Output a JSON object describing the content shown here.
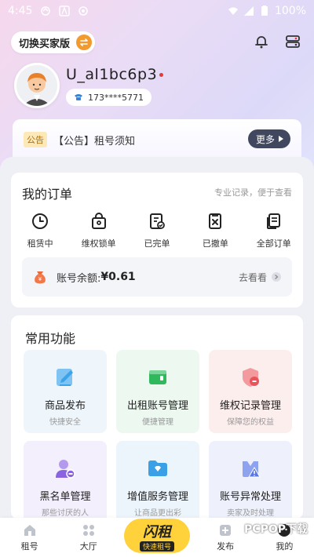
{
  "status_bar": {
    "time": "4:45",
    "battery": "100%"
  },
  "header": {
    "switch_label": "切换买家版"
  },
  "profile": {
    "username": "U_al1bc6p3",
    "phone": "173****5771"
  },
  "notice": {
    "tag": "公告",
    "text": "【公告】租号须知",
    "more_label": "更多"
  },
  "orders": {
    "title": "我的订单",
    "subtitle": "专业记录，便于查看",
    "items": [
      {
        "label": "租赁中",
        "icon": "clock-icon"
      },
      {
        "label": "维权锁单",
        "icon": "lock-bag-icon"
      },
      {
        "label": "已完单",
        "icon": "completed-doc-icon"
      },
      {
        "label": "已撤单",
        "icon": "cancelled-doc-icon"
      },
      {
        "label": "全部订单",
        "icon": "all-orders-icon"
      }
    ],
    "balance_label": "账号余额:",
    "balance_value": "¥0.61",
    "balance_action": "去看看"
  },
  "functions": {
    "title": "常用功能",
    "items": [
      {
        "label": "商品发布",
        "sub": "快捷安全",
        "icon": "edit-icon",
        "bg": "#eef6fc",
        "color": "#3da3e8"
      },
      {
        "label": "出租账号管理",
        "sub": "便捷管理",
        "icon": "wallet-icon",
        "bg": "#edf8f1",
        "color": "#2fb85c"
      },
      {
        "label": "维权记录管理",
        "sub": "保障您的权益",
        "icon": "shield-icon",
        "bg": "#fdeeee",
        "color": "#e8545a"
      },
      {
        "label": "黑名单管理",
        "sub": "那些讨厌的人",
        "icon": "user-block-icon",
        "bg": "#f3effc",
        "color": "#8a63e0"
      },
      {
        "label": "增值服务管理",
        "sub": "让商品更出彩",
        "icon": "folder-icon",
        "bg": "#edf5fc",
        "color": "#3ba0e6"
      },
      {
        "label": "账号异常处理",
        "sub": "卖家及时处理",
        "icon": "alert-bag-icon",
        "bg": "#eef1fc",
        "color": "#5b79e6"
      }
    ]
  },
  "tabbar": {
    "tabs": [
      {
        "label": "租号"
      },
      {
        "label": "大厅"
      },
      {
        "label": "发布"
      },
      {
        "label": "我的"
      }
    ],
    "center_main": "闪租",
    "center_sub": "快速租号"
  },
  "watermark": "PCPOP下载"
}
